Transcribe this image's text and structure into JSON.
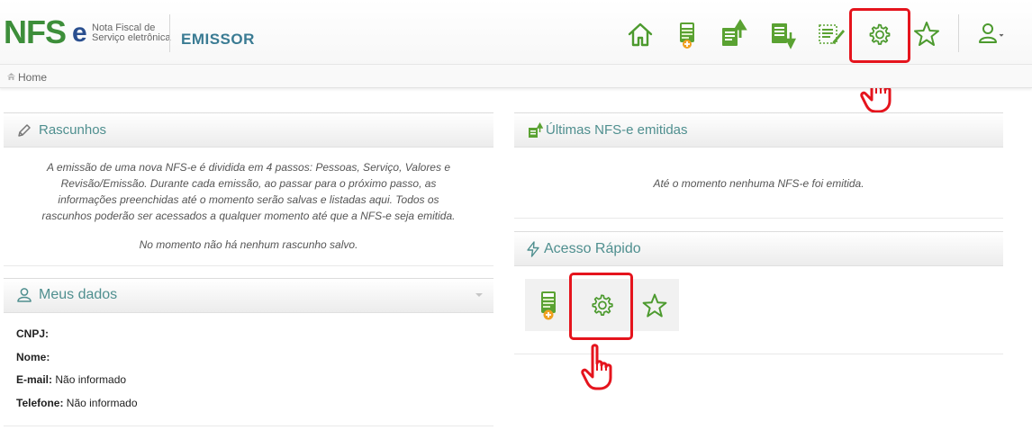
{
  "header": {
    "logo": {
      "main": "NFS",
      "e": "e",
      "line1": "Nota Fiscal de",
      "line2": "Serviço eletrônica"
    },
    "app_title": "EMISSOR",
    "icons": [
      "home-icon",
      "nfse-new-icon",
      "issued-icon",
      "download-doc-icon",
      "edit-doc-icon",
      "gear-icon",
      "star-icon",
      "user-icon"
    ]
  },
  "breadcrumb": {
    "home": "Home"
  },
  "rascunhos": {
    "title": "Rascunhos",
    "description_lines": [
      "A emissão de uma nova NFS-e é dividida em 4 passos: Pessoas, Serviço, Valores e",
      "Revisão/Emissão. Durante cada emissão, ao passar para o próximo passo, as",
      "informações preenchidas até o momento serão salvas e listadas aqui. Todos os",
      "rascunhos poderão ser acessados a qualquer momento até que a NFS-e seja emitida."
    ],
    "empty": "No momento não há nenhum rascunho salvo."
  },
  "meus_dados": {
    "title": "Meus dados",
    "fields": [
      {
        "label": "CNPJ:",
        "value": ""
      },
      {
        "label": "Nome:",
        "value": ""
      },
      {
        "label": "E-mail:",
        "value": "Não informado"
      },
      {
        "label": "Telefone:",
        "value": "Não informado"
      }
    ]
  },
  "ultimas": {
    "title": "Últimas NFS-e emitidas",
    "empty": "Até o momento nenhuma NFS-e foi emitida."
  },
  "acesso_rapido": {
    "title": "Acesso Rápido",
    "items": [
      "nfse-new-icon",
      "gear-icon",
      "star-icon"
    ]
  },
  "colors": {
    "green": "#3d8e3a",
    "teal": "#4f8f8f",
    "highlight": "#e5141d"
  }
}
